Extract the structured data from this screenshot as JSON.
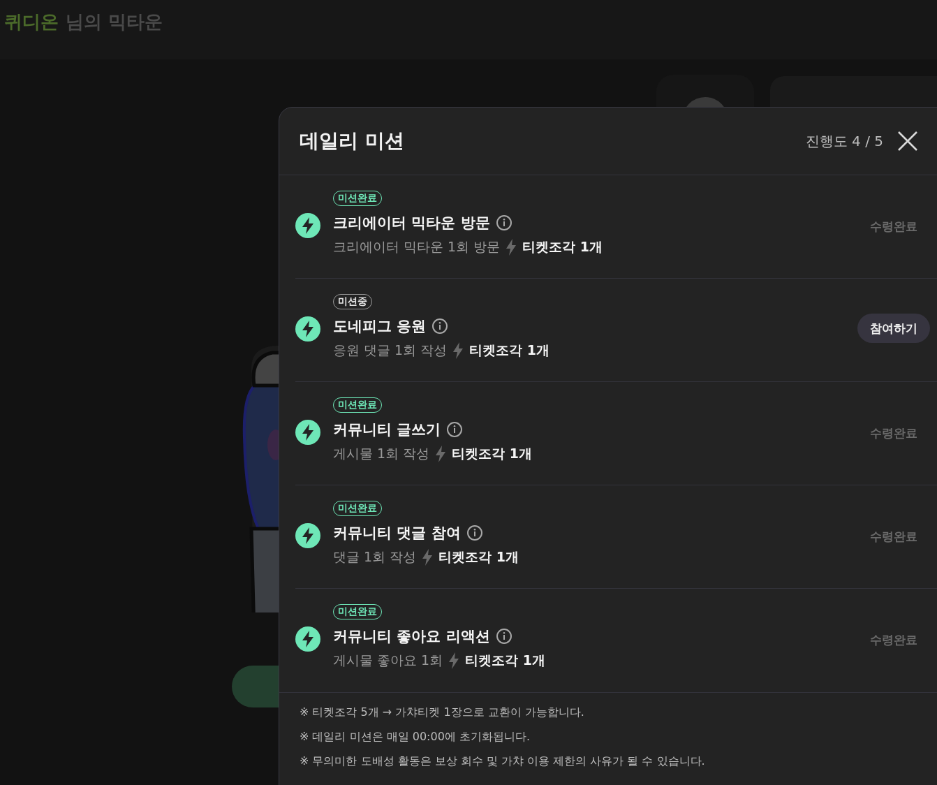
{
  "header": {
    "name": "퀴디온",
    "suffix": "님의 믹타운"
  },
  "modal": {
    "title": "데일리 미션",
    "progress": "진행도 4 / 5",
    "missions": [
      {
        "badge": {
          "kind": "done",
          "label": "미션완료"
        },
        "title": "크리에이터 믹타운 방문",
        "description": "크리에이터 믹타운 1회 방문",
        "reward": "티켓조각 1개",
        "action": {
          "kind": "status",
          "label": "수령완료"
        }
      },
      {
        "badge": {
          "kind": "ongoing",
          "label": "미션중"
        },
        "title": "도네피그 응원",
        "description": "응원 댓글 1회 작성",
        "reward": "티켓조각 1개",
        "action": {
          "kind": "button",
          "label": "참여하기"
        }
      },
      {
        "badge": {
          "kind": "done",
          "label": "미션완료"
        },
        "title": "커뮤니티 글쓰기",
        "description": "게시물 1회 작성",
        "reward": "티켓조각 1개",
        "action": {
          "kind": "status",
          "label": "수령완료"
        }
      },
      {
        "badge": {
          "kind": "done",
          "label": "미션완료"
        },
        "title": "커뮤니티 댓글 참여",
        "description": "댓글 1회 작성",
        "reward": "티켓조각 1개",
        "action": {
          "kind": "status",
          "label": "수령완료"
        }
      },
      {
        "badge": {
          "kind": "done",
          "label": "미션완료"
        },
        "title": "커뮤니티 좋아요 리액션",
        "description": "게시물 좋아요 1회",
        "reward": "티켓조각 1개",
        "action": {
          "kind": "status",
          "label": "수령완료"
        }
      }
    ],
    "notes": [
      "※ 티켓조각 5개 → 가챠티켓 1장으로 교환이 가능합니다.",
      "※ 데일리 미션은 매일 00:00에 초기화됩니다.",
      "※ 무의미한 도배성 활동은 보상 회수 및 가챠 이용 제한의 사유가 될 수 있습니다."
    ]
  }
}
